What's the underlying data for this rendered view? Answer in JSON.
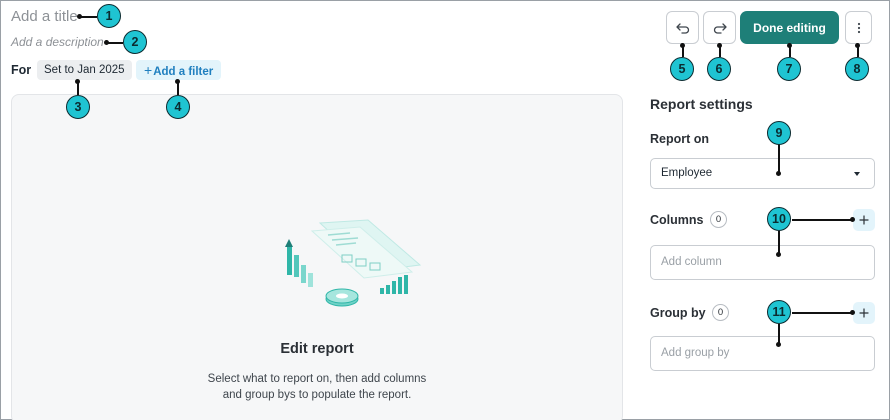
{
  "header": {
    "title_placeholder": "Add a title",
    "description_placeholder": "Add a description",
    "for_label": "For",
    "date_chip": "Set to Jan 2025",
    "add_filter": "Add a filter"
  },
  "toolbar": {
    "done_label": "Done editing",
    "icons": [
      "undo-icon",
      "redo-icon",
      "more-vertical-icon"
    ]
  },
  "empty_state": {
    "title": "Edit report",
    "text_line1": "Select what to report on, then add columns",
    "text_line2": "and group bys to populate the report."
  },
  "settings": {
    "title": "Report settings",
    "report_on": {
      "label": "Report on",
      "value": "Employee"
    },
    "columns": {
      "label": "Columns",
      "count": "0",
      "placeholder": "Add column"
    },
    "group_by": {
      "label": "Group by",
      "count": "0",
      "placeholder": "Add group by"
    }
  },
  "callouts": [
    "1",
    "2",
    "3",
    "4",
    "5",
    "6",
    "7",
    "8",
    "9",
    "10",
    "11"
  ],
  "colors": {
    "accent": "#1e7f78",
    "callout": "#1fc4d2",
    "filter_text": "#1f7fbf",
    "filter_bg": "#e3f4fb"
  }
}
